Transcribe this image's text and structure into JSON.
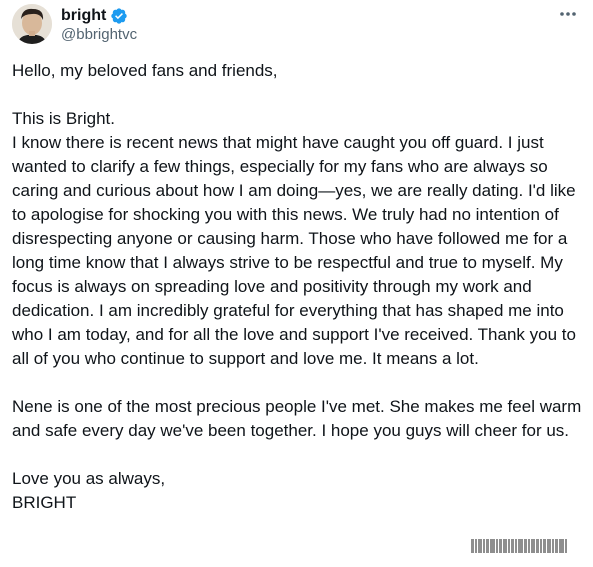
{
  "author": {
    "display_name": "bright",
    "handle": "@bbrightvc",
    "verified": true,
    "avatar_icon": "profile-photo",
    "verified_icon": "verified-badge-icon",
    "verified_color": "#1d9bf0"
  },
  "menu_icon": "more-options-icon",
  "tweet": {
    "greeting": "Hello, my beloved fans and friends,",
    "paragraph_1": "This is Bright.\nI know there is recent news that might have caught you off guard. I just wanted to clarify a few things, especially for my fans who are always so caring and curious about how I am doing—yes, we are really dating. I'd like to apologise for shocking you with this news. We truly had no intention of disrespecting anyone or causing harm. Those who have followed me for a long time know that I always strive to be respectful and true to myself. My focus is always on spreading love and positivity through my work and dedication. I am incredibly grateful for everything that has shaped me into who I am today, and for all the love and support I've received. Thank you to all of you who continue to support and love me. It means a lot.",
    "paragraph_2": "Nene is one of the most precious people I've met. She makes me feel warm and safe every day we've been together. I hope you guys will cheer for us.",
    "closing": "Love you as always,\nBRIGHT"
  },
  "colors": {
    "text": "#0f1419",
    "secondary_text": "#536471"
  }
}
